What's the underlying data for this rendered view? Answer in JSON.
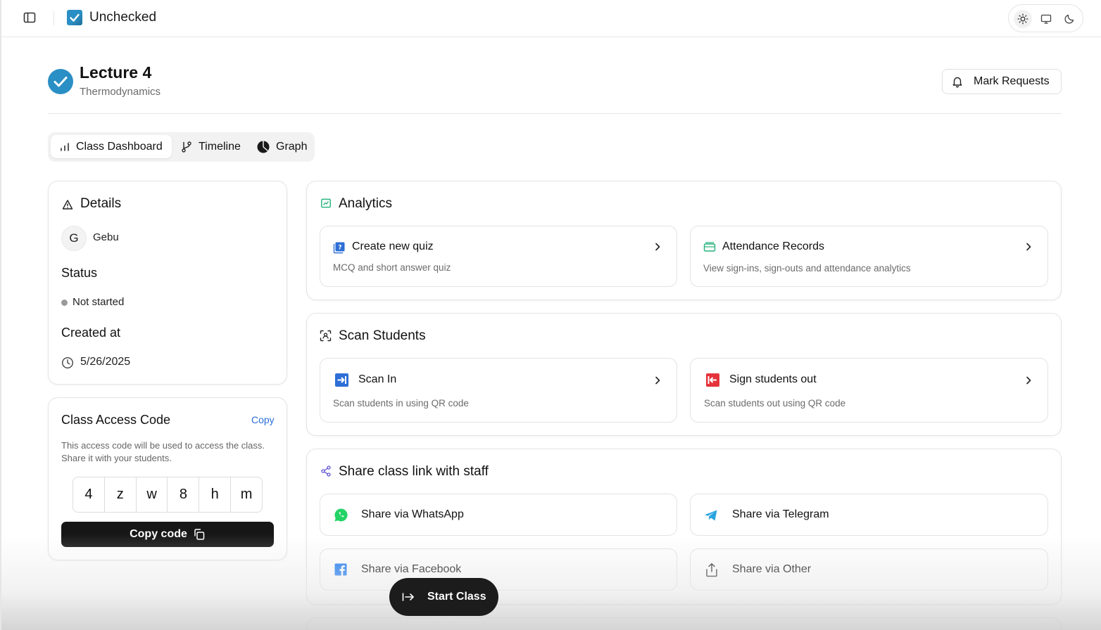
{
  "app": {
    "title": "Unchecked"
  },
  "theme": {
    "options": [
      "light",
      "system",
      "dark"
    ],
    "active": "light"
  },
  "lecture": {
    "title": "Lecture 4",
    "subtitle": "Thermodynamics"
  },
  "header": {
    "mark_requests": "Mark Requests"
  },
  "tabs": [
    {
      "label": "Class Dashboard",
      "icon": "bar-chart-icon",
      "active": true
    },
    {
      "label": "Timeline",
      "icon": "git-branch-icon",
      "active": false
    },
    {
      "label": "Graph",
      "icon": "pie-chart-icon",
      "active": false
    }
  ],
  "details": {
    "title": "Details",
    "owner_initial": "G",
    "owner_name": "Gebu",
    "status_label": "Status",
    "status_value": "Not started",
    "created_label": "Created at",
    "created_value": "5/26/2025"
  },
  "access": {
    "title": "Class Access Code",
    "copy_link": "Copy",
    "description": "This access code will be used to access the class. Share it with your students.",
    "code": [
      "4",
      "z",
      "w",
      "8",
      "h",
      "m"
    ],
    "copy_button": "Copy code"
  },
  "analytics": {
    "title": "Analytics",
    "tiles": [
      {
        "title": "Create new quiz",
        "desc": "MCQ and short answer quiz",
        "icon": "quiz-icon"
      },
      {
        "title": "Attendance Records",
        "desc": "View sign-ins, sign-outs and attendance analytics",
        "icon": "records-icon"
      }
    ]
  },
  "scan": {
    "title": "Scan Students",
    "tiles": [
      {
        "title": "Scan In",
        "desc": "Scan students in using QR code",
        "icon": "scan-in-icon"
      },
      {
        "title": "Sign students out",
        "desc": "Scan students out using QR code",
        "icon": "sign-out-icon"
      }
    ]
  },
  "share": {
    "title": "Share class link with staff",
    "options": [
      {
        "label": "Share via WhatsApp",
        "icon": "whatsapp-icon"
      },
      {
        "label": "Share via Telegram",
        "icon": "telegram-icon"
      },
      {
        "label": "Share via Facebook",
        "icon": "facebook-icon"
      },
      {
        "label": "Share via Other",
        "icon": "share-upload-icon"
      }
    ]
  },
  "start_button": "Start Class",
  "colors": {
    "brand": "#2a8fc4",
    "primary_dark": "#171717",
    "link": "#2d6fd6",
    "whatsapp": "#25d366",
    "telegram": "#2aa3e0",
    "facebook": "#1877f2",
    "scan_in": "#2d6fd6",
    "sign_out": "#e5333b"
  }
}
